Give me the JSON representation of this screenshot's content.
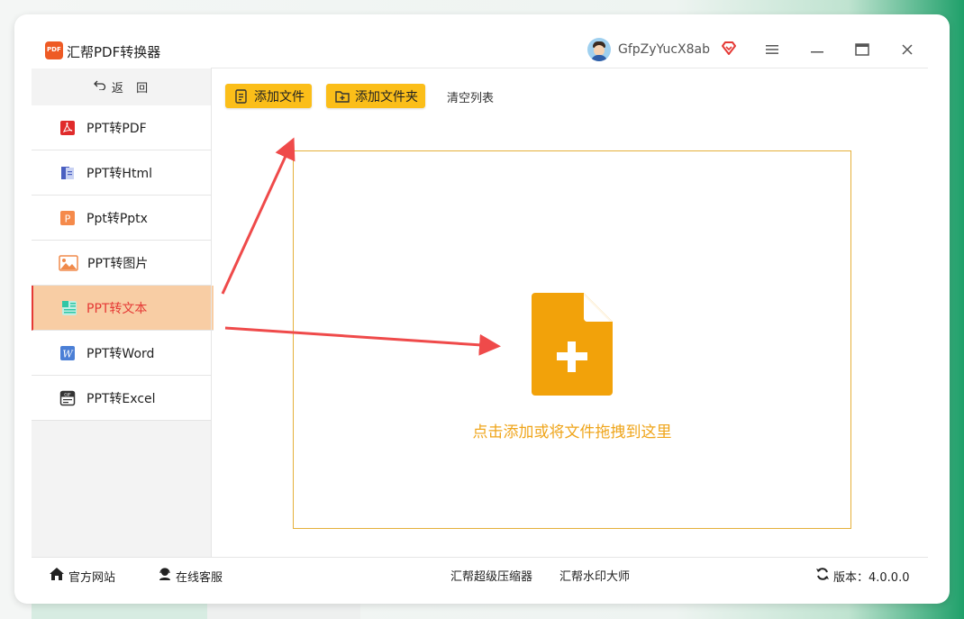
{
  "app": {
    "title": "汇帮PDF转换器",
    "logo_text": "PDF"
  },
  "user": {
    "name": "GfpZyYucX8ab"
  },
  "sidebar": {
    "back_label": "返  回",
    "items": [
      {
        "label": "PPT转PDF",
        "icon": "pdf-icon",
        "active": false
      },
      {
        "label": "PPT转Html",
        "icon": "html-icon",
        "active": false
      },
      {
        "label": "Ppt转Pptx",
        "icon": "pptx-icon",
        "active": false
      },
      {
        "label": "PPT转图片",
        "icon": "image-icon",
        "active": false
      },
      {
        "label": "PPT转文本",
        "icon": "text-icon",
        "active": true
      },
      {
        "label": "PPT转Word",
        "icon": "word-icon",
        "active": false
      },
      {
        "label": "PPT转Excel",
        "icon": "excel-icon",
        "active": false
      }
    ]
  },
  "toolbar": {
    "add_file": "添加文件",
    "add_folder": "添加文件夹",
    "clear_list": "清空列表"
  },
  "dropzone": {
    "text": "点击添加或将文件拖拽到这里"
  },
  "statusbar": {
    "website": "官方网站",
    "support": "在线客服",
    "compressor": "汇帮超级压缩器",
    "watermark": "汇帮水印大师",
    "version": "版本：4.0.0.0"
  },
  "colors": {
    "accent": "#fbbe19",
    "active_bg": "#f8cda4",
    "active_text": "#e53935",
    "drop_orange": "#f2a20a",
    "arrow_red": "#ef4a4a"
  }
}
